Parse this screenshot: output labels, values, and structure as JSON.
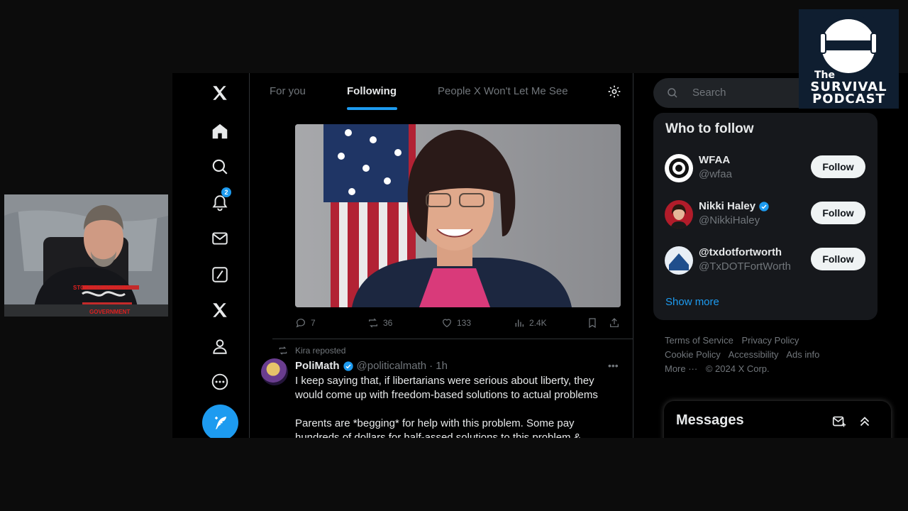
{
  "nav": {
    "notification_count": "2",
    "items": [
      "x-logo",
      "home",
      "explore",
      "notifications",
      "messages",
      "grok",
      "premium",
      "profile",
      "more"
    ]
  },
  "tabs": [
    {
      "label": "For you",
      "active": false
    },
    {
      "label": "Following",
      "active": true
    },
    {
      "label": "People X Won't Let Me See",
      "active": false
    }
  ],
  "tweet1": {
    "actions": {
      "replies": "7",
      "reposts": "36",
      "likes": "133",
      "views": "2.4K"
    }
  },
  "tweet2": {
    "repost_label": "Kira reposted",
    "author_name": "PoliMath",
    "author_handle": "@politicalmath",
    "time": "· 1h",
    "text_line1": "I keep saying that, if libertarians were serious about liberty, they",
    "text_line2": "would come up with freedom-based solutions to actual problems",
    "text_line3": "Parents are *begging* for help with this problem. Some pay",
    "text_line4": "hundreds of dollars for half-assed solutions to this problem &"
  },
  "search": {
    "placeholder": "Search"
  },
  "who_to_follow": {
    "title": "Who to follow",
    "accounts": [
      {
        "name": "WFAA",
        "handle": "@wfaa",
        "verified": false,
        "button": "Follow"
      },
      {
        "name": "Nikki Haley",
        "handle": "@NikkiHaley",
        "verified": true,
        "button": "Follow"
      },
      {
        "name": "@txdotfortworth",
        "handle": "@TxDOTFortWorth",
        "verified": false,
        "button": "Follow"
      }
    ],
    "show_more": "Show more"
  },
  "footer": {
    "links": [
      "Terms of Service",
      "Privacy Policy",
      "Cookie Policy",
      "Accessibility",
      "Ads info",
      "More ···",
      "© 2024 X Corp."
    ]
  },
  "messages": {
    "title": "Messages"
  },
  "logo": {
    "line1": "The",
    "line2": "SURVIVAL",
    "line3": "PODCAST"
  },
  "webcam": {
    "shirt_text_top": "STOP BELIEVING IN",
    "shirt_text_bottom": "GOVERNMENT"
  },
  "colors": {
    "accent": "#1d9bf0",
    "background": "#000000",
    "text": "#e7e9ea",
    "muted": "#71767b"
  }
}
